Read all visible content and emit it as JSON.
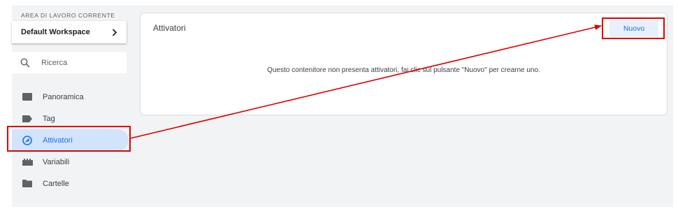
{
  "sidebar": {
    "workspace_caption": "AREA DI LAVORO CORRENTE",
    "workspace_name": "Default Workspace",
    "search_placeholder": "Ricerca",
    "items": [
      {
        "label": "Panoramica",
        "icon": "overview-icon",
        "active": false
      },
      {
        "label": "Tag",
        "icon": "tag-icon",
        "active": false
      },
      {
        "label": "Attivatori",
        "icon": "trigger-icon",
        "active": true
      },
      {
        "label": "Variabili",
        "icon": "variables-icon",
        "active": false
      },
      {
        "label": "Cartelle",
        "icon": "folder-icon",
        "active": false
      }
    ]
  },
  "main": {
    "title": "Attivatori",
    "new_button_label": "Nuovo",
    "empty_message": "Questo contenitore non presenta attivatori, fai clic sul pulsante \"Nuovo\" per crearne uno."
  },
  "colors": {
    "accent": "#1a73e8",
    "active_bg": "#d2e3fc",
    "annotation_red": "#e00000",
    "icon_gray": "#5f6368"
  }
}
